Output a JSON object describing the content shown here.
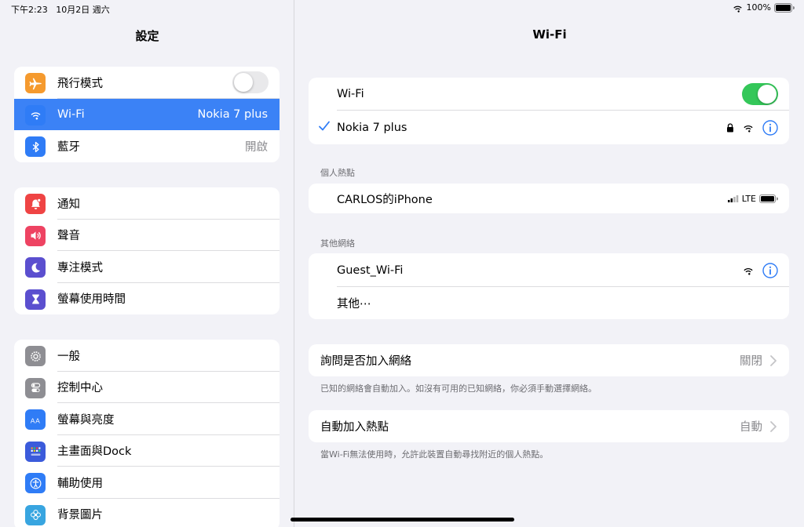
{
  "status": {
    "time": "下午2:23",
    "date": "10月2日 週六",
    "battery": "100%"
  },
  "sidebar": {
    "title": "設定",
    "group1": [
      {
        "label": "飛行模式",
        "value": ""
      },
      {
        "label": "Wi-Fi",
        "value": "Nokia 7 plus"
      },
      {
        "label": "藍牙",
        "value": "開啟"
      }
    ],
    "group2": [
      {
        "label": "通知"
      },
      {
        "label": "聲音"
      },
      {
        "label": "專注模式"
      },
      {
        "label": "螢幕使用時間"
      }
    ],
    "group3": [
      {
        "label": "一般"
      },
      {
        "label": "控制中心"
      },
      {
        "label": "螢幕與亮度"
      },
      {
        "label": "主畫面與Dock"
      },
      {
        "label": "輔助使用"
      },
      {
        "label": "背景圖片"
      }
    ],
    "airplane_mode_on": false
  },
  "detail": {
    "title": "Wi-Fi",
    "wifi_label": "Wi-Fi",
    "wifi_on": true,
    "connected_network": "Nokia 7 plus",
    "hotspot_header": "個人熱點",
    "hotspot_name": "CARLOS的iPhone",
    "hotspot_signal": "LTE",
    "other_header": "其他網絡",
    "other_networks": [
      "Guest_Wi-Fi",
      "其他⋯"
    ],
    "ask_join_label": "詢問是否加入網絡",
    "ask_join_value": "關閉",
    "ask_join_note": "已知的網絡會自動加入。如沒有可用的已知網絡，你必須手動選擇網絡。",
    "auto_hotspot_label": "自動加入熱點",
    "auto_hotspot_value": "自動",
    "auto_hotspot_note": "當Wi-Fi無法使用時，允許此裝置自動尋找附近的個人熱點。"
  },
  "colors": {
    "accent": "#3b82f6",
    "toggle_on": "#34c759",
    "icon_airplane": "#f59a2e",
    "icon_wifi": "#2f7cf6",
    "icon_bluetooth": "#2f7cf6",
    "icon_notifications": "#ef4444",
    "icon_sounds": "#ee4362",
    "icon_focus": "#5b4fcf",
    "icon_screentime": "#5b4fcf",
    "icon_general": "#8e8e93",
    "icon_control": "#8e8e93",
    "icon_display": "#2f7cf6",
    "icon_home": "#3b5bdb",
    "icon_accessibility": "#2f7cf6",
    "icon_wallpaper": "#38a5e0"
  }
}
